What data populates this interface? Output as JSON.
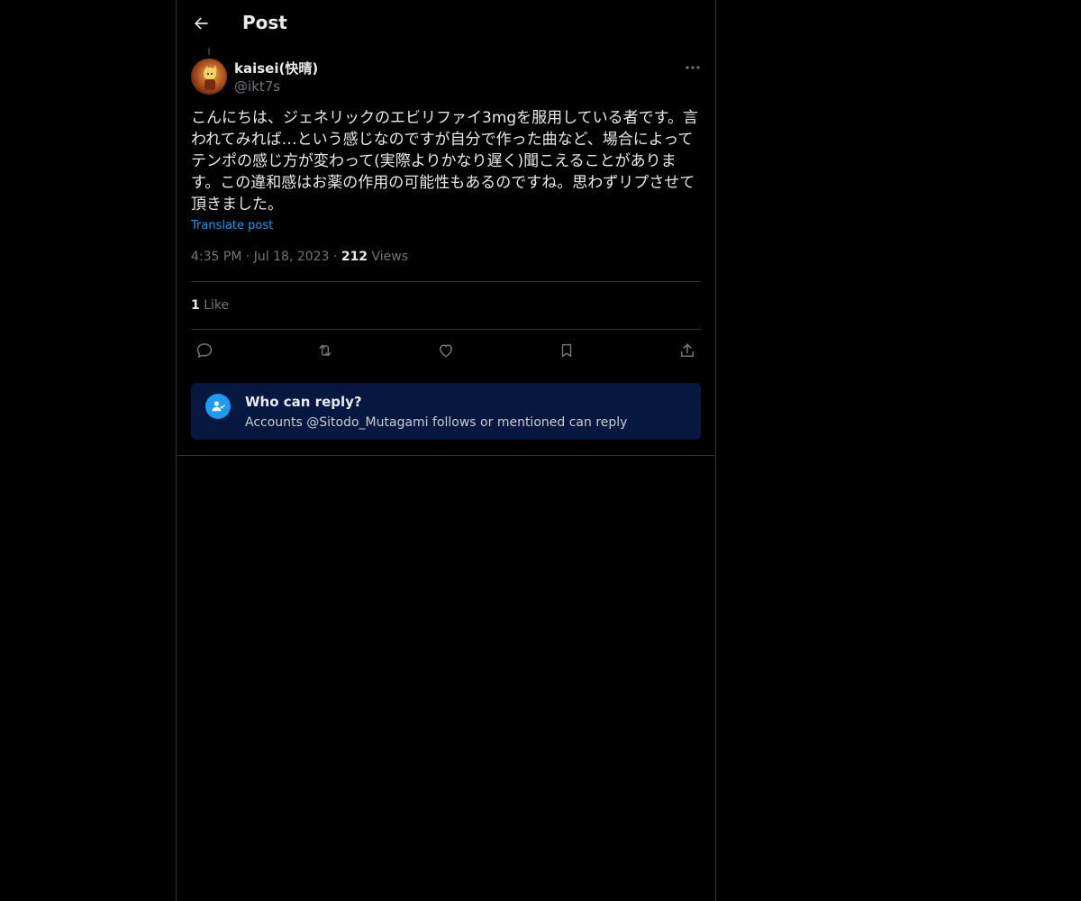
{
  "header": {
    "title": "Post"
  },
  "post": {
    "author": {
      "display_name": "kaisei(快晴)",
      "handle": "@ikt7s"
    },
    "text": "こんにちは、ジェネリックのエビリファイ3mgを服用している者です。言われてみれば…という感じなのですが自分で作った曲など、場合によってテンポの感じ方が変わって(実際よりかなり遅く)聞こえることがあります。この違和感はお薬の作用の可能性もあるのですね。思わずリプさせて頂きました。",
    "translate_label": "Translate post",
    "time": "4:35 PM",
    "date": "Jul 18, 2023",
    "separator": "·",
    "views_count": "212",
    "views_label": "Views",
    "likes_count": "1",
    "likes_label": "Like"
  },
  "actions": {
    "reply": "reply-icon",
    "repost": "repost-icon",
    "like": "heart-icon",
    "bookmark": "bookmark-icon",
    "share": "share-icon"
  },
  "reply_restriction": {
    "title": "Who can reply?",
    "subtitle": "Accounts @Sitodo_Mutagami follows or mentioned can reply"
  },
  "colors": {
    "background": "#000000",
    "text": "#e7e9ea",
    "muted": "#71767b",
    "accent": "#1d9bf0",
    "border": "#2f3336",
    "reply_box": "#061840"
  }
}
